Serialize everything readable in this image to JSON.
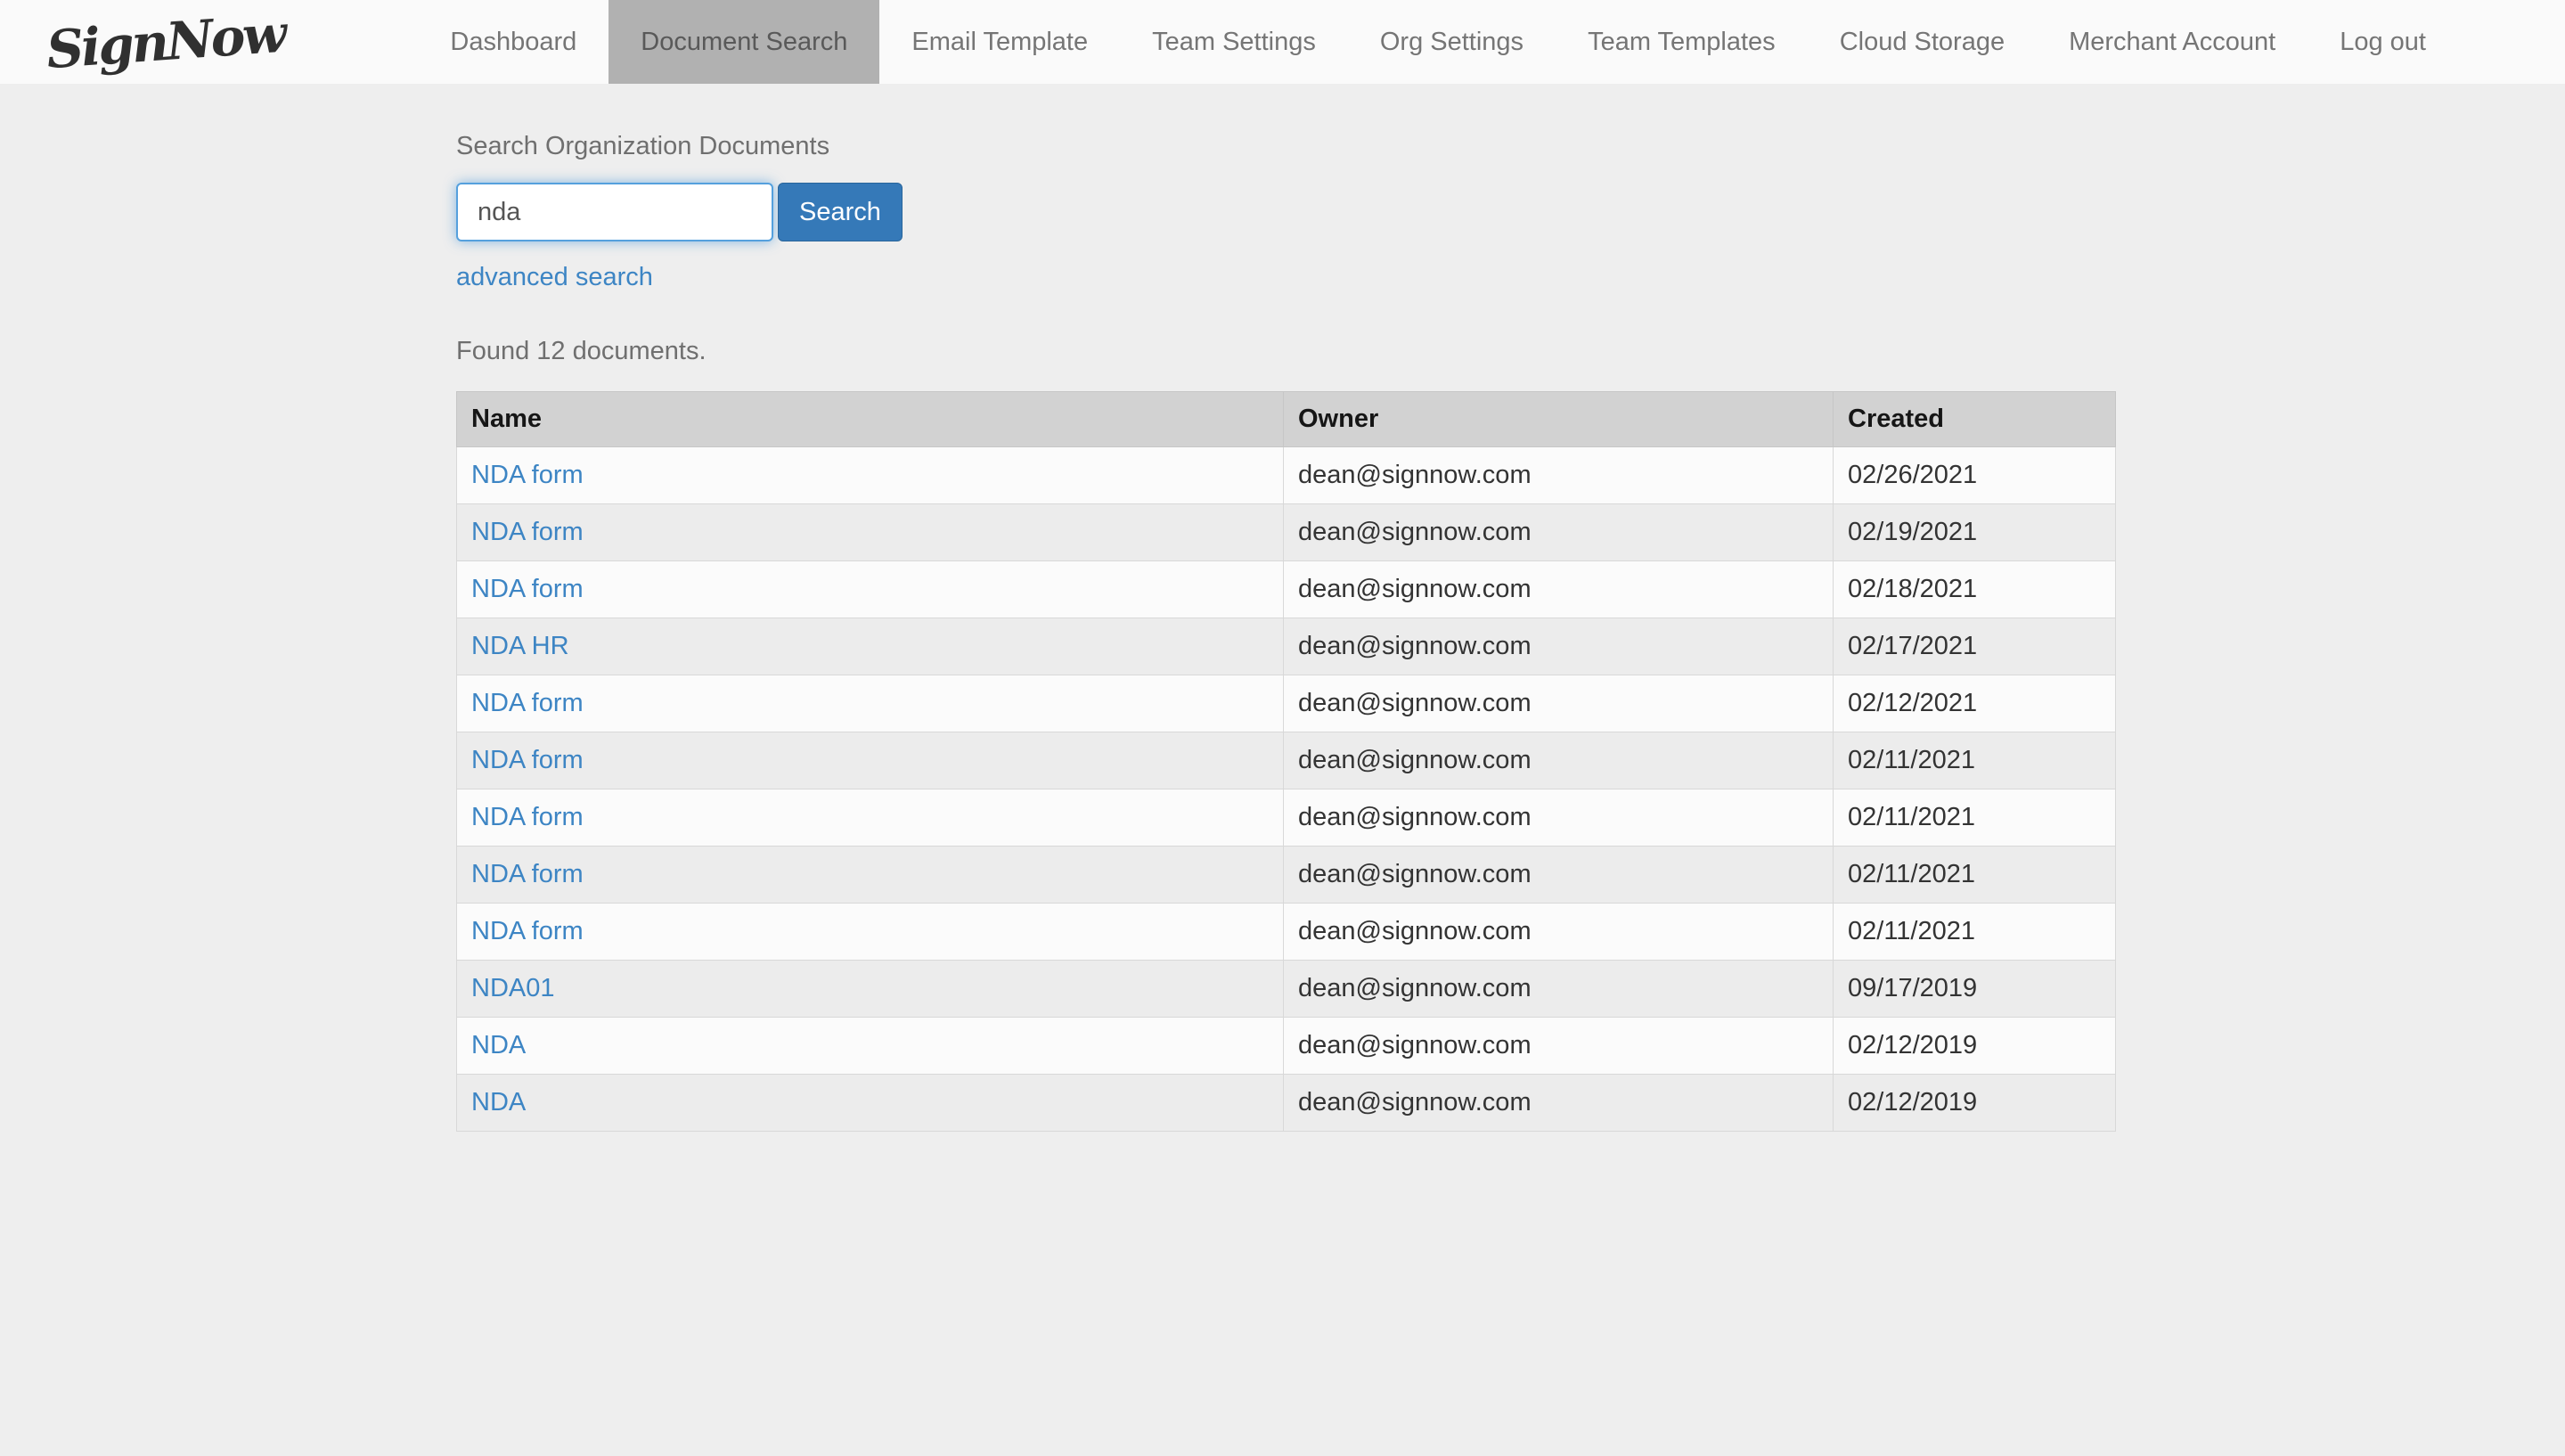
{
  "header": {
    "logo_text": "SignNow",
    "nav_items": [
      {
        "label": "Dashboard",
        "active": false
      },
      {
        "label": "Document Search",
        "active": true
      },
      {
        "label": "Email Template",
        "active": false
      },
      {
        "label": "Team Settings",
        "active": false
      },
      {
        "label": "Org Settings",
        "active": false
      },
      {
        "label": "Team Templates",
        "active": false
      },
      {
        "label": "Cloud Storage",
        "active": false
      },
      {
        "label": "Merchant Account",
        "active": false
      },
      {
        "label": "Log out",
        "active": false
      }
    ]
  },
  "search": {
    "label": "Search Organization Documents",
    "input_value": "nda",
    "button_label": "Search",
    "advanced_search_label": "advanced search"
  },
  "results": {
    "summary": "Found 12 documents.",
    "columns": [
      "Name",
      "Owner",
      "Created"
    ],
    "rows": [
      {
        "name": "NDA form",
        "owner": "dean@signnow.com",
        "created": "02/26/2021"
      },
      {
        "name": "NDA form",
        "owner": "dean@signnow.com",
        "created": "02/19/2021"
      },
      {
        "name": "NDA form",
        "owner": "dean@signnow.com",
        "created": "02/18/2021"
      },
      {
        "name": "NDA HR",
        "owner": "dean@signnow.com",
        "created": "02/17/2021"
      },
      {
        "name": "NDA form",
        "owner": "dean@signnow.com",
        "created": "02/12/2021"
      },
      {
        "name": "NDA form",
        "owner": "dean@signnow.com",
        "created": "02/11/2021"
      },
      {
        "name": "NDA form",
        "owner": "dean@signnow.com",
        "created": "02/11/2021"
      },
      {
        "name": "NDA form",
        "owner": "dean@signnow.com",
        "created": "02/11/2021"
      },
      {
        "name": "NDA form",
        "owner": "dean@signnow.com",
        "created": "02/11/2021"
      },
      {
        "name": "NDA01",
        "owner": "dean@signnow.com",
        "created": "09/17/2019"
      },
      {
        "name": "NDA",
        "owner": "dean@signnow.com",
        "created": "02/12/2019"
      },
      {
        "name": "NDA",
        "owner": "dean@signnow.com",
        "created": "02/12/2019"
      }
    ]
  },
  "colors": {
    "page_bg": "#eeeeee",
    "header_bg": "#fafafa",
    "active_tab_gray": "#b1b1b1",
    "accent_blue": "#3579b8",
    "link_blue": "#3d85c4",
    "table_header_bg": "#d2d2d2"
  }
}
